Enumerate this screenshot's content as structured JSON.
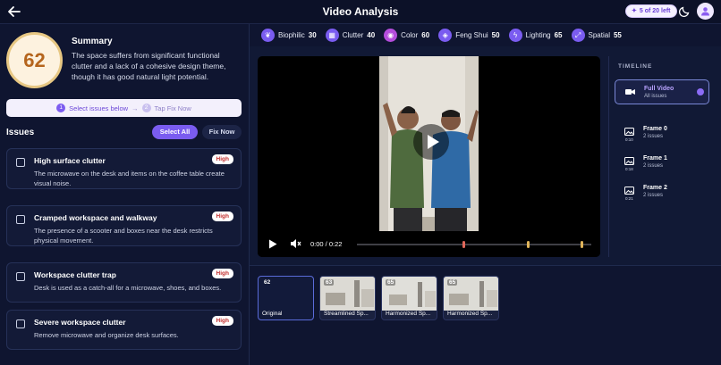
{
  "header": {
    "title": "Video Analysis",
    "credits": "5 of 20 left"
  },
  "summary": {
    "score": "62",
    "title": "Summary",
    "text": "The space suffers from significant functional clutter and a lack of a cohesive design theme, though it has good natural light potential."
  },
  "steps": {
    "step1_num": "1",
    "step1": "Select issues below",
    "arrow": "→",
    "step2_num": "2",
    "step2": "Tap Fix Now"
  },
  "issues": {
    "title": "Issues",
    "select_all": "Select All",
    "fix_now": "Fix Now",
    "items": [
      {
        "title": "High surface clutter",
        "severity": "High",
        "desc": "The microwave on the desk and items on the coffee table create visual noise."
      },
      {
        "title": "Cramped workspace and walkway",
        "severity": "High",
        "desc": "The presence of a scooter and boxes near the desk restricts physical movement."
      },
      {
        "title": "Workspace clutter trap",
        "severity": "High",
        "desc": "Desk is used as a catch-all for a microwave, shoes, and boxes."
      },
      {
        "title": "Severe workspace clutter",
        "severity": "High",
        "desc": "Remove microwave and organize desk surfaces."
      }
    ]
  },
  "metrics": [
    {
      "label": "Biophilic",
      "value": "30",
      "icon": "leaf-icon"
    },
    {
      "label": "Clutter",
      "value": "40",
      "icon": "grid-icon"
    },
    {
      "label": "Color",
      "value": "60",
      "icon": "palette-icon"
    },
    {
      "label": "Feng Shui",
      "value": "50",
      "icon": "compass-icon"
    },
    {
      "label": "Lighting",
      "value": "65",
      "icon": "bolt-icon"
    },
    {
      "label": "Spatial",
      "value": "55",
      "icon": "expand-icon"
    }
  ],
  "video": {
    "time": "0:00 / 0:22"
  },
  "timeline": {
    "title": "TIMELINE",
    "items": [
      {
        "title": "Full Video",
        "sub": "All issues",
        "time": ""
      },
      {
        "title": "Frame 0",
        "sub": "2 issues",
        "time": "0:10"
      },
      {
        "title": "Frame 1",
        "sub": "2 issues",
        "time": "0:18"
      },
      {
        "title": "Frame 2",
        "sub": "2 issues",
        "time": "0:21"
      }
    ]
  },
  "thumbnails": [
    {
      "score": "62",
      "label": "Original"
    },
    {
      "score": "63",
      "label": "Streamlined Sp..."
    },
    {
      "score": "65",
      "label": "Harmonized Sp..."
    },
    {
      "score": "65",
      "label": "Harmonized Sp..."
    }
  ],
  "colors": {
    "accent": "#7a5cf0",
    "background": "#0f1530",
    "high": "#c22d2d"
  }
}
